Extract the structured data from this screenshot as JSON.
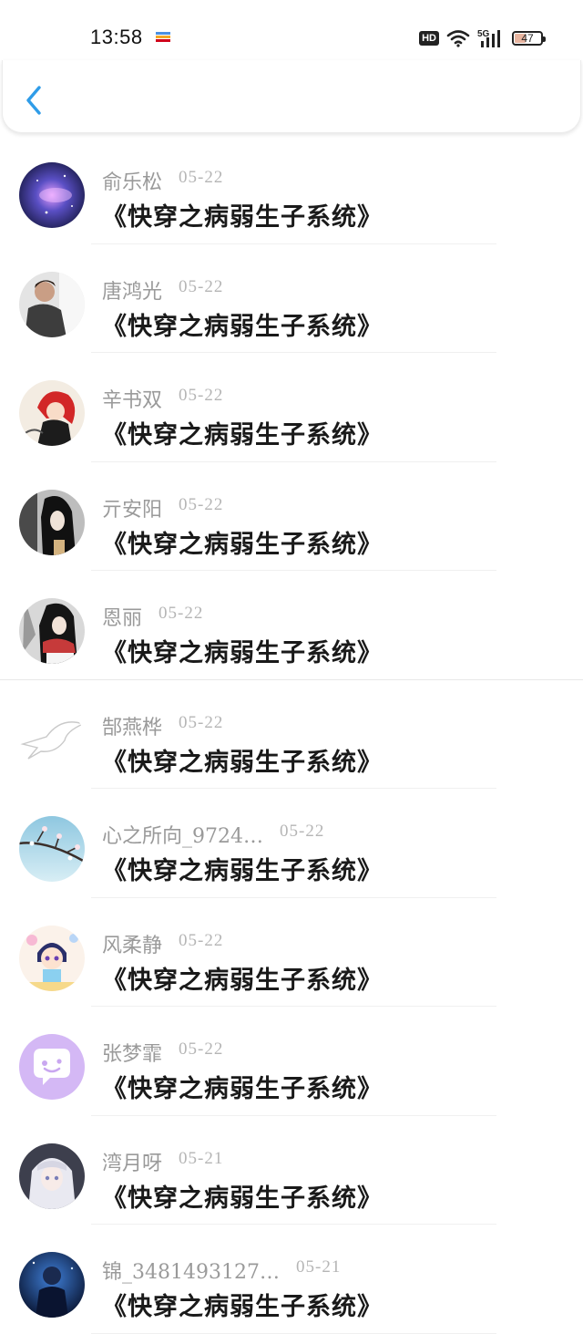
{
  "status_bar": {
    "time": "13:58",
    "hd_label": "HD",
    "network_label": "5G",
    "battery_level": "47"
  },
  "header": {
    "back_icon": "chevron-left-icon",
    "accent_color": "#2f9ce8"
  },
  "comments": [
    {
      "user": "俞乐松",
      "date": "05-22",
      "text": "《快穿之病弱生子系统》",
      "avatar": "galaxy"
    },
    {
      "user": "唐鸿光",
      "date": "05-22",
      "text": "《快穿之病弱生子系统》",
      "avatar": "person-dark-jacket"
    },
    {
      "user": "辛书双",
      "date": "05-22",
      "text": "《快穿之病弱生子系统》",
      "avatar": "red-hair-anime"
    },
    {
      "user": "亓安阳",
      "date": "05-22",
      "text": "《快穿之病弱生子系统》",
      "avatar": "long-black-hair"
    },
    {
      "user": "恩丽",
      "date": "05-22",
      "text": "《快穿之病弱生子系统》",
      "avatar": "girl-red-scarf"
    },
    {
      "user": "郜燕桦",
      "date": "05-22",
      "text": "《快穿之病弱生子系统》",
      "avatar": "bird-sketch"
    },
    {
      "user": "心之所向_9724…",
      "date": "05-22",
      "text": "《快穿之病弱生子系统》",
      "avatar": "blossom-branch"
    },
    {
      "user": "风柔静",
      "date": "05-22",
      "text": "《快穿之病弱生子系统》",
      "avatar": "chibi-character"
    },
    {
      "user": "张梦霏",
      "date": "05-22",
      "text": "《快穿之病弱生子系统》",
      "avatar": "purple-chat-bubble"
    },
    {
      "user": "湾月呀",
      "date": "05-21",
      "text": "《快穿之病弱生子系统》",
      "avatar": "white-hair-anime"
    },
    {
      "user": "锦_3481493127…",
      "date": "05-21",
      "text": "《快穿之病弱生子系统》",
      "avatar": "blue-night-figure"
    }
  ]
}
